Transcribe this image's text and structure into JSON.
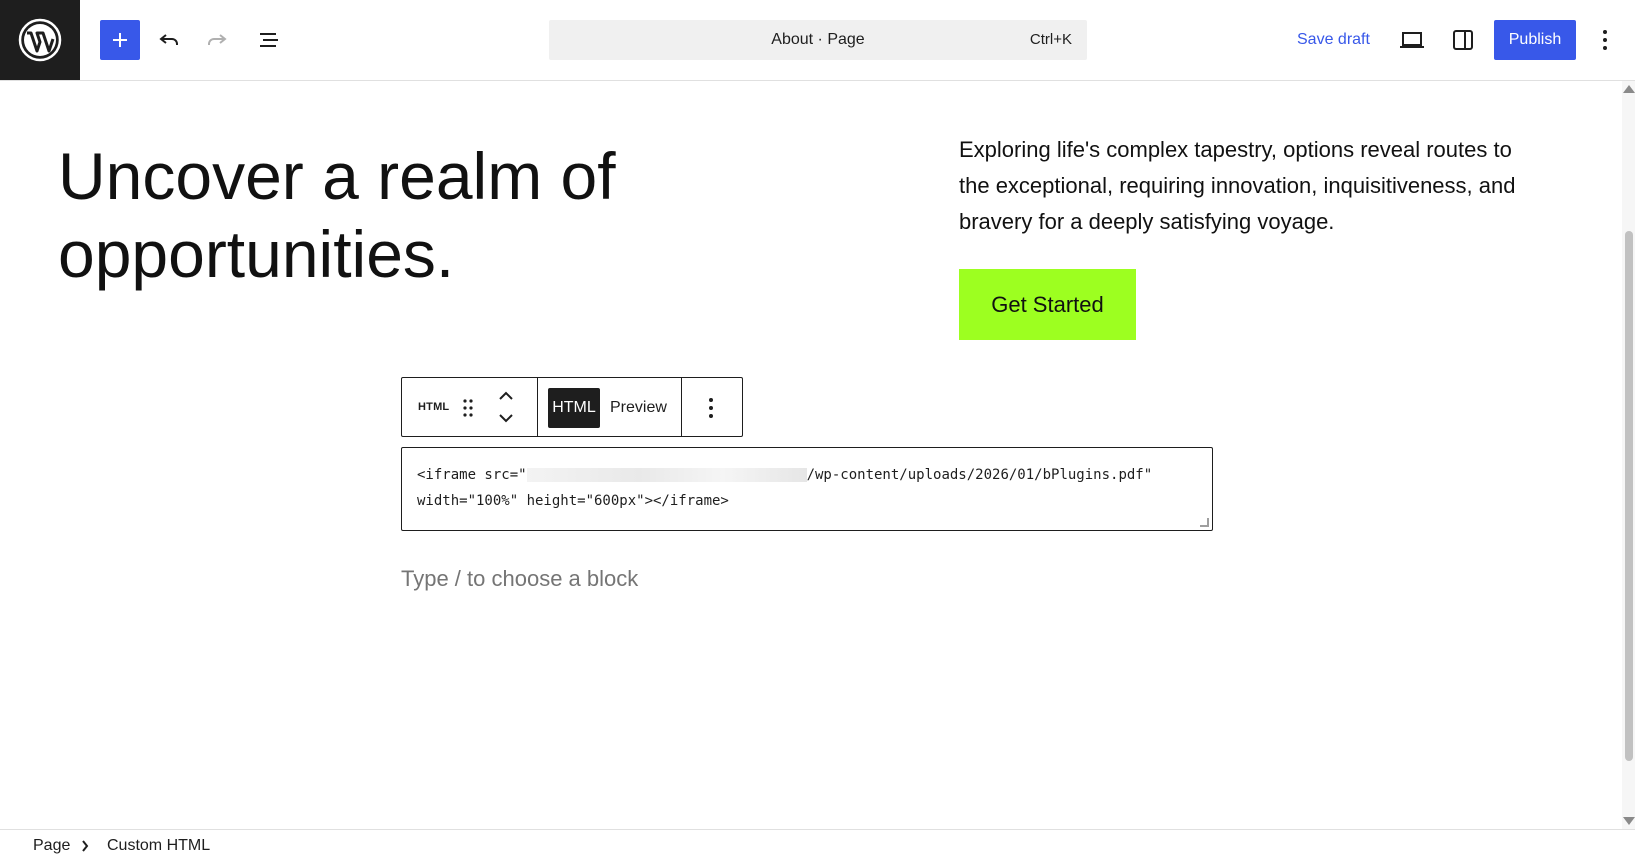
{
  "header": {
    "document_title": "About · Page",
    "shortcut": "Ctrl+K",
    "save_draft_label": "Save draft",
    "publish_label": "Publish"
  },
  "colors": {
    "accent": "#3858e9",
    "cta_bg": "#9dff20",
    "logo_bg": "#1e1e1e"
  },
  "content": {
    "headline": "Uncover a realm of opportunities.",
    "lede": "Exploring life's complex tapestry, options reveal routes to the exceptional, requiring innovation, inquisitiveness, and bravery for a deeply satisfying voyage.",
    "cta_label": "Get Started"
  },
  "block_toolbar": {
    "block_label": "HTML",
    "tab_html": "HTML",
    "tab_preview": "Preview"
  },
  "code": {
    "line1_prefix": "<iframe src=\"",
    "line1_suffix": "/wp-content/uploads/2026/01/bPlugins.pdf\"",
    "line2": "width=\"100%\" height=\"600px\"></iframe>"
  },
  "placeholder": "Type / to choose a block",
  "breadcrumb": {
    "items": [
      "Page",
      "Custom HTML"
    ]
  },
  "icons": [
    "wordpress-logo-icon",
    "plus-icon",
    "undo-icon",
    "redo-icon",
    "list-view-icon",
    "desktop-view-icon",
    "sidebar-toggle-icon",
    "more-vertical-icon",
    "drag-handle-icon",
    "chevron-up-icon",
    "chevron-down-icon",
    "chevron-right-icon"
  ]
}
